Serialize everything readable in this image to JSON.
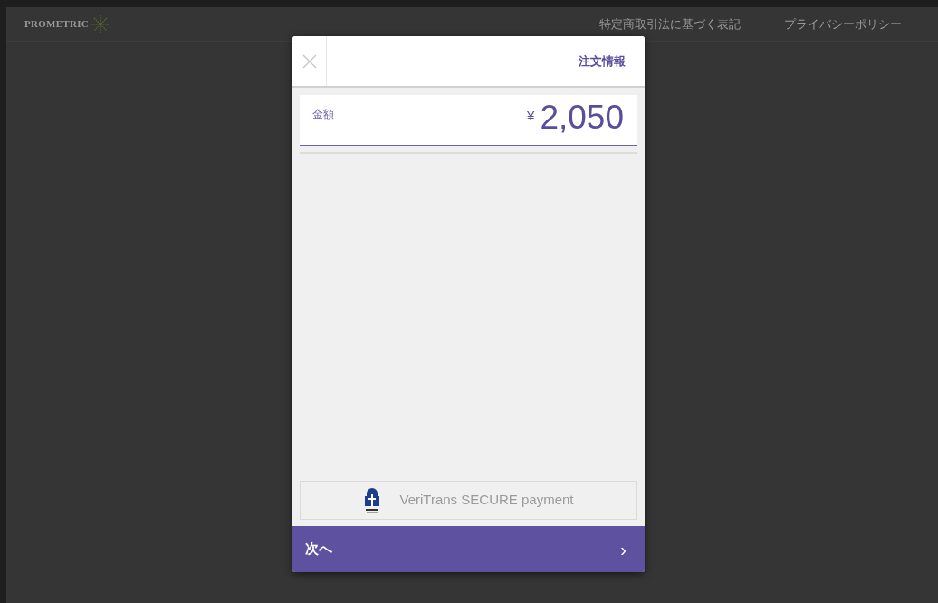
{
  "header": {
    "logo": "PROMETRIC",
    "links": [
      "特定商取引法に基づく表記",
      "プライバシーポリシー"
    ]
  },
  "modal": {
    "title": "注文情報",
    "amount_label": "金額",
    "currency": "¥",
    "amount": "2,050",
    "secure_label": "VeriTrans SECURE payment",
    "next_button": "次へ",
    "next_arrow": "›"
  }
}
